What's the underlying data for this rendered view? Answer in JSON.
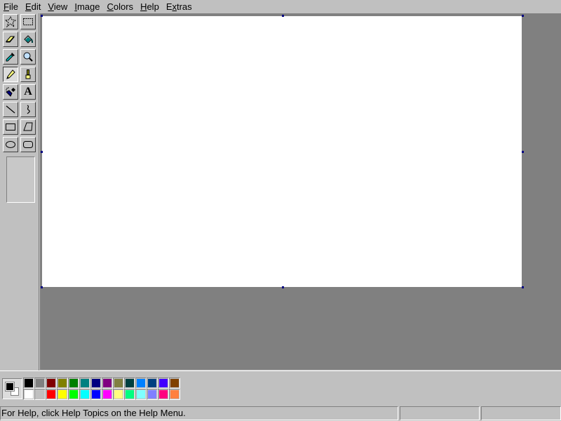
{
  "menu": [
    {
      "label": "File",
      "access": "F",
      "rest": "ile"
    },
    {
      "label": "Edit",
      "access": "E",
      "rest": "dit"
    },
    {
      "label": "View",
      "access": "V",
      "rest": "iew"
    },
    {
      "label": "Image",
      "access": "I",
      "rest": "mage"
    },
    {
      "label": "Colors",
      "access": "C",
      "rest": "olors"
    },
    {
      "label": "Help",
      "access": "H",
      "rest": "elp"
    },
    {
      "label": "Extras",
      "access": "x",
      "pre": "E",
      "rest": "tras"
    }
  ],
  "tools": [
    {
      "name": "free-form-select",
      "icon": "free-form-select-icon",
      "active": false
    },
    {
      "name": "select",
      "icon": "rectangle-select-icon",
      "active": false
    },
    {
      "name": "eraser",
      "icon": "eraser-icon",
      "active": false
    },
    {
      "name": "fill-with-color",
      "icon": "paint-bucket-icon",
      "active": false
    },
    {
      "name": "pick-color",
      "icon": "eyedropper-icon",
      "active": false
    },
    {
      "name": "magnifier",
      "icon": "magnifier-icon",
      "active": false
    },
    {
      "name": "pencil",
      "icon": "pencil-icon",
      "active": true
    },
    {
      "name": "brush",
      "icon": "brush-icon",
      "active": false
    },
    {
      "name": "airbrush",
      "icon": "airbrush-icon",
      "active": false
    },
    {
      "name": "text",
      "icon": "text-icon",
      "active": false,
      "glyph": "A"
    },
    {
      "name": "line",
      "icon": "line-icon",
      "active": false
    },
    {
      "name": "curve",
      "icon": "curve-icon",
      "active": false
    },
    {
      "name": "rectangle",
      "icon": "rectangle-icon",
      "active": false
    },
    {
      "name": "polygon",
      "icon": "polygon-icon",
      "active": false
    },
    {
      "name": "ellipse",
      "icon": "ellipse-icon",
      "active": false
    },
    {
      "name": "rounded-rectangle",
      "icon": "rounded-rectangle-icon",
      "active": false
    }
  ],
  "colors": {
    "foreground": "#000000",
    "background": "#ffffff",
    "palette_top": [
      "#000000",
      "#808080",
      "#800000",
      "#808000",
      "#008000",
      "#008080",
      "#000080",
      "#800080",
      "#808040",
      "#004040",
      "#0080ff",
      "#004080",
      "#4000ff",
      "#804000"
    ],
    "palette_bottom": [
      "#ffffff",
      "#c0c0c0",
      "#ff0000",
      "#ffff00",
      "#00ff00",
      "#00ffff",
      "#0000ff",
      "#ff00ff",
      "#ffff80",
      "#00ff80",
      "#80ffff",
      "#8080ff",
      "#ff0080",
      "#ff8040"
    ]
  },
  "status": {
    "help_text": "For Help, click Help Topics on the Help Menu.",
    "position": "",
    "size": ""
  }
}
